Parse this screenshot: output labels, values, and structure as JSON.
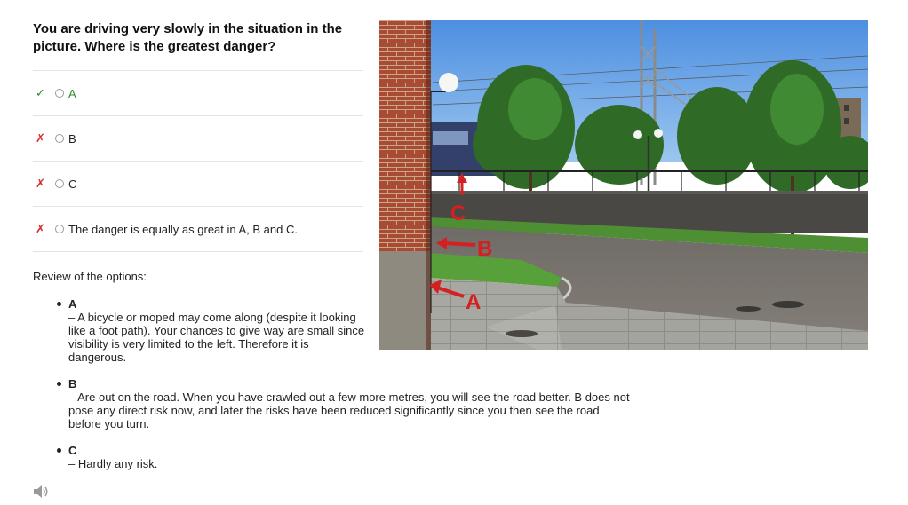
{
  "question": "You are driving very slowly in the situation in the picture. Where is the greatest danger?",
  "options": [
    {
      "mark": "✓",
      "status": "correct",
      "label": "A"
    },
    {
      "mark": "✗",
      "status": "wrong",
      "label": "B"
    },
    {
      "mark": "✗",
      "status": "wrong",
      "label": "C"
    },
    {
      "mark": "✗",
      "status": "wrong",
      "label": "The danger is equally as great in A, B and C."
    }
  ],
  "review": {
    "heading": "Review of the options:",
    "items": [
      {
        "letter": "A",
        "text": "– A bicycle or moped may come along (despite it looking like a foot path). Your chances to give way are small since visibility is very limited to the left. Therefore it is dangerous."
      },
      {
        "letter": "B",
        "text": "– Are out on the road. When you have crawled out a few more metres, you will see the road better. B does not pose any direct risk now, and later the risks have been reduced significantly since you then see the road before you turn."
      },
      {
        "letter": "C",
        "text": "– Hardly any risk."
      }
    ]
  },
  "photo": {
    "label_a": "A",
    "label_b": "B",
    "label_c": "C",
    "arrow_color": "#d42020"
  },
  "colors": {
    "correct": "#2e8b2e",
    "wrong": "#d12b2b"
  },
  "icons": {
    "audio": "speaker-icon"
  }
}
